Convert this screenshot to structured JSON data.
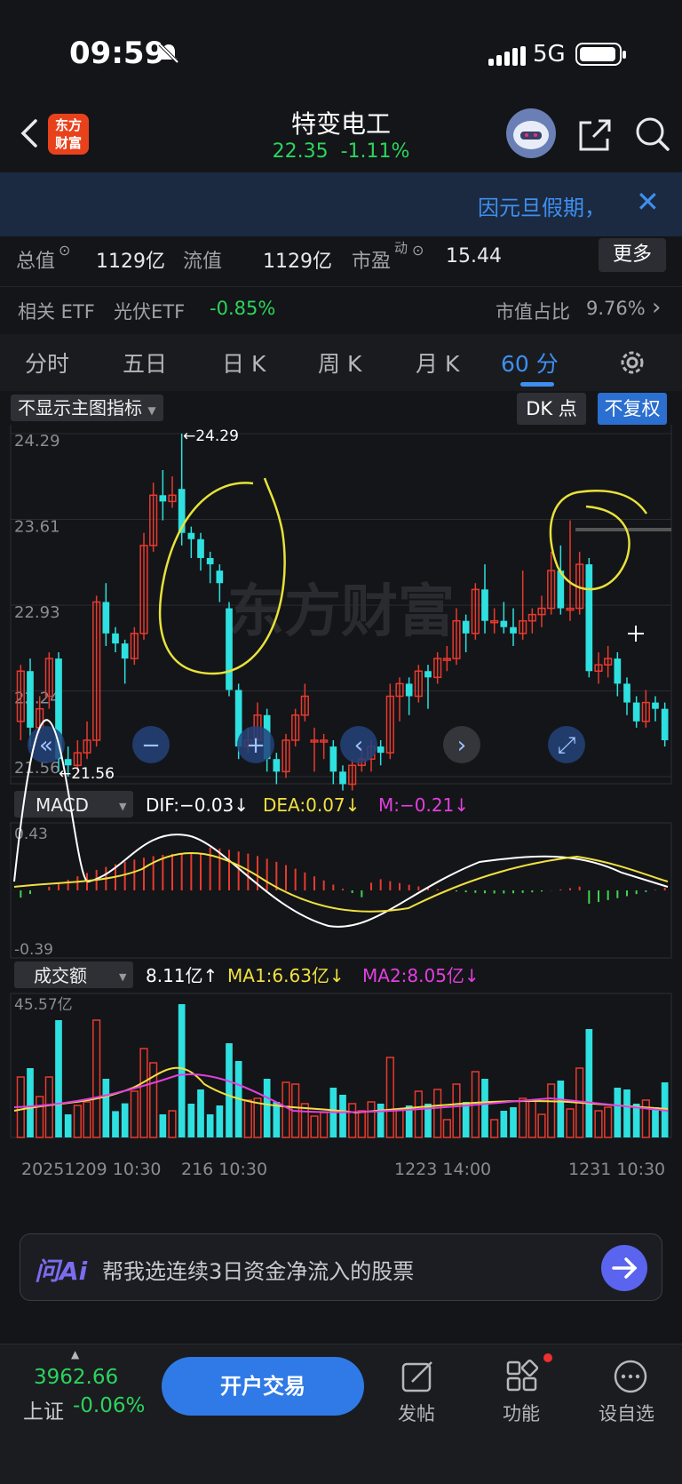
{
  "status_bar": {
    "time": "09:59",
    "network": "5G"
  },
  "header": {
    "logo_text": "东方财富",
    "stock_name": "特变电工",
    "price": "22.35",
    "change_pct": "-1.11%"
  },
  "banner": {
    "text": "因元旦假期，"
  },
  "stats": {
    "total_value_label": "总值",
    "total_value": "1129亿",
    "float_value_label": "流值",
    "float_value": "1129亿",
    "pe_label": "市盈",
    "pe_sup": "动",
    "pe_value": "15.44",
    "more_label": "更多"
  },
  "etf": {
    "related_label": "相关 ETF",
    "etf_name": "光伏ETF",
    "etf_change": "-0.85%",
    "share_label": "市值占比",
    "share_value": "9.76%"
  },
  "tabs": [
    "分时",
    "五日",
    "日 K",
    "周 K",
    "月 K",
    "60 分"
  ],
  "active_tab": "60 分",
  "chart_controls": {
    "indicator_select": "不显示主图指标",
    "dk_label": "DK 点",
    "adjust_label": "不复权"
  },
  "chart_data": {
    "type": "candlestick",
    "price_axis": [
      "24.29",
      "23.61",
      "22.93",
      "22.24",
      "21.56"
    ],
    "max_label": "24.29",
    "min_label": "21.56",
    "watermark": "东方财富",
    "candles": [
      [
        22.0,
        22.4,
        22.45,
        21.85
      ],
      [
        22.4,
        21.95,
        22.5,
        21.8
      ],
      [
        21.95,
        22.1,
        22.2,
        21.9
      ],
      [
        22.2,
        22.5,
        22.55,
        22.1
      ],
      [
        22.5,
        21.7,
        22.55,
        21.6
      ],
      [
        21.7,
        21.65,
        21.8,
        21.56
      ],
      [
        21.65,
        21.75,
        21.85,
        21.6
      ],
      [
        21.75,
        21.85,
        22.0,
        21.7
      ],
      [
        21.85,
        22.95,
        23.0,
        21.8
      ],
      [
        22.95,
        22.7,
        23.1,
        22.6
      ],
      [
        22.7,
        22.62,
        22.75,
        22.55
      ],
      [
        22.62,
        22.5,
        22.65,
        22.3
      ],
      [
        22.5,
        22.7,
        22.75,
        22.45
      ],
      [
        22.7,
        23.4,
        23.5,
        22.65
      ],
      [
        23.4,
        23.8,
        23.9,
        23.35
      ],
      [
        23.8,
        23.75,
        24.0,
        23.6
      ],
      [
        23.75,
        23.8,
        23.95,
        23.7
      ],
      [
        23.85,
        23.5,
        24.29,
        23.4
      ],
      [
        23.5,
        23.45,
        23.55,
        23.3
      ],
      [
        23.45,
        23.3,
        23.5,
        23.2
      ],
      [
        23.3,
        23.25,
        23.35,
        23.1
      ],
      [
        23.2,
        23.1,
        23.25,
        22.95
      ],
      [
        22.9,
        22.25,
        22.95,
        22.2
      ],
      [
        22.25,
        21.8,
        22.3,
        21.7
      ],
      [
        21.8,
        21.85,
        21.95,
        21.75
      ],
      [
        21.85,
        22.05,
        22.15,
        21.85
      ],
      [
        22.05,
        21.7,
        22.1,
        21.6
      ],
      [
        21.7,
        21.6,
        21.75,
        21.5
      ],
      [
        21.6,
        21.85,
        21.9,
        21.55
      ],
      [
        21.85,
        22.05,
        22.1,
        21.8
      ],
      [
        22.05,
        22.2,
        22.3,
        22.0
      ],
      [
        21.85,
        21.85,
        21.95,
        21.6
      ],
      [
        21.85,
        21.85,
        21.9,
        21.7
      ],
      [
        21.8,
        21.6,
        21.85,
        21.5
      ],
      [
        21.6,
        21.5,
        21.65,
        21.45
      ],
      [
        21.5,
        21.65,
        21.7,
        21.45
      ],
      [
        21.65,
        21.7,
        21.8,
        21.6
      ],
      [
        21.7,
        21.8,
        21.85,
        21.6
      ],
      [
        21.8,
        21.75,
        21.85,
        21.65
      ],
      [
        21.75,
        22.2,
        22.3,
        21.7
      ],
      [
        22.2,
        22.3,
        22.35,
        22.0
      ],
      [
        22.3,
        22.2,
        22.35,
        22.05
      ],
      [
        22.2,
        22.4,
        22.45,
        22.15
      ],
      [
        22.4,
        22.35,
        22.45,
        22.1
      ],
      [
        22.35,
        22.5,
        22.55,
        22.3
      ],
      [
        22.5,
        22.5,
        22.6,
        22.4
      ],
      [
        22.5,
        22.8,
        22.9,
        22.45
      ],
      [
        22.8,
        22.7,
        22.85,
        22.55
      ],
      [
        22.7,
        23.05,
        23.1,
        22.65
      ],
      [
        23.05,
        22.8,
        23.25,
        22.7
      ],
      [
        22.8,
        22.8,
        22.9,
        22.7
      ],
      [
        22.8,
        22.75,
        22.95,
        22.7
      ],
      [
        22.75,
        22.7,
        22.9,
        22.6
      ],
      [
        22.7,
        22.8,
        23.2,
        22.65
      ],
      [
        22.8,
        22.85,
        22.9,
        22.7
      ],
      [
        22.85,
        22.9,
        23.0,
        22.75
      ],
      [
        22.9,
        23.2,
        23.35,
        22.85
      ],
      [
        23.2,
        22.9,
        23.4,
        22.85
      ],
      [
        22.9,
        22.9,
        23.6,
        22.8
      ],
      [
        22.9,
        23.25,
        23.35,
        22.85
      ],
      [
        23.25,
        22.4,
        23.3,
        22.35
      ],
      [
        22.4,
        22.45,
        22.55,
        22.3
      ],
      [
        22.45,
        22.5,
        22.6,
        22.35
      ],
      [
        22.5,
        22.3,
        22.55,
        22.2
      ],
      [
        22.3,
        22.15,
        22.35,
        22.05
      ],
      [
        22.15,
        22.0,
        22.2,
        21.95
      ],
      [
        22.0,
        22.15,
        22.25,
        21.95
      ],
      [
        22.15,
        22.1,
        22.2,
        22.0
      ],
      [
        22.1,
        21.85,
        22.15,
        21.8
      ]
    ],
    "annotations": "two hand-drawn yellow circles",
    "macd": {
      "label": "MACD",
      "dif": "DIF:−0.03",
      "dea": "DEA:0.07",
      "m": "M:−0.21",
      "axis_top": "0.43",
      "axis_bottom": "-0.39"
    },
    "volume": {
      "label": "成交额",
      "value": "8.11亿",
      "ma1": "MA1:6.63亿",
      "ma2": "MA2:8.05亿",
      "axis_top": "45.57亿"
    },
    "x_labels": [
      "20251209 10:30",
      "216 10:30",
      "1223 14:00",
      "1231 10:30"
    ]
  },
  "ai_bar": {
    "logo": "问Ai",
    "prompt": "帮我选连续3日资金净流入的股票"
  },
  "bottom_bar": {
    "index_value": "3962.66",
    "index_name": "上证",
    "index_change": "-0.06%",
    "trade_label": "开户交易",
    "post_label": "发帖",
    "func_label": "功能",
    "watch_label": "设自选"
  },
  "colors": {
    "up": "#e83a2e",
    "down": "#2ee0e0",
    "accent": "#3e8ff0",
    "green_text": "#2bd45d"
  }
}
